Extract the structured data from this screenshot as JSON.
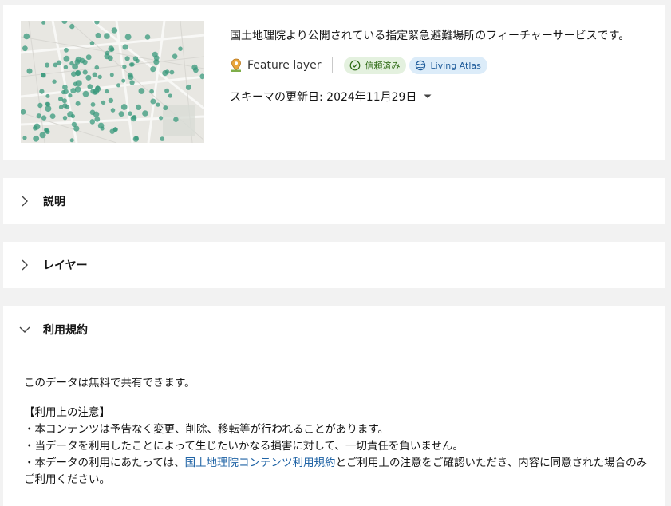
{
  "summary": {
    "description": "国土地理院より公開されている指定緊急避難場所のフィーチャーサービスです。",
    "item_type": "Feature layer",
    "type_icon": "feature-layer-icon",
    "badges": [
      {
        "label": "信頼済み",
        "icon": "check-circle-icon",
        "color": "#2d6a14"
      },
      {
        "label": "Living Atlas",
        "icon": "living-atlas-icon",
        "color": "#1e5b9a"
      }
    ],
    "schema_updated": "スキーマの更新日: 2024年11月29日"
  },
  "sections": {
    "description_title": "説明",
    "layers_title": "レイヤー",
    "terms_title": "利用規約"
  },
  "terms": {
    "line1": "このデータは無料で共有できます。",
    "notice_title": "【利用上の注意】",
    "item1": "・本コンテンツは予告なく変更、削除、移転等が行われることがあります。",
    "item2": "・当データを利用したことによって生じたいかなる損害に対して、一切責任を負いません。",
    "item3_prefix": "・本データの利用にあたっては、",
    "item3_link": "国土地理院コンテンツ利用規約",
    "item3_suffix": "とご利用上の注意をご確認いただき、内容に同意された場合のみご利用ください。"
  },
  "colors": {
    "accent_link": "#1f63a5",
    "point_color": "#3a9a7c"
  }
}
